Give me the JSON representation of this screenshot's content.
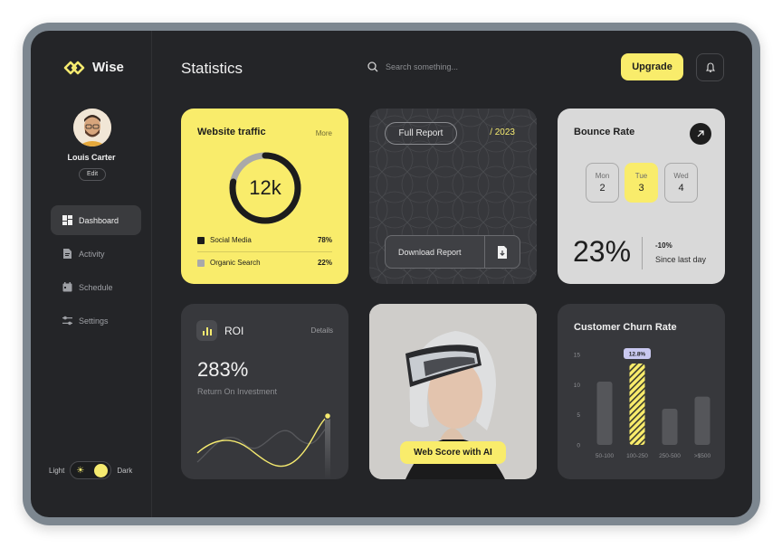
{
  "brand": {
    "name": "Wise"
  },
  "user": {
    "name": "Louis Carter",
    "edit_label": "Edit"
  },
  "nav": {
    "items": [
      {
        "label": "Dashboard",
        "icon": "grid-icon",
        "active": true
      },
      {
        "label": "Activity",
        "icon": "document-icon",
        "active": false
      },
      {
        "label": "Schedule",
        "icon": "calendar-icon",
        "active": false
      },
      {
        "label": "Settings",
        "icon": "sliders-icon",
        "active": false
      }
    ]
  },
  "theme": {
    "light_label": "Light",
    "dark_label": "Dark",
    "mode": "dark"
  },
  "header": {
    "title": "Statistics",
    "search_placeholder": "Search something...",
    "upgrade_label": "Upgrade"
  },
  "traffic": {
    "title": "Website traffic",
    "more_label": "More",
    "value": "12k",
    "ring_fraction": 0.78,
    "legend": [
      {
        "label": "Social Media",
        "percent": "78%",
        "color": "#1c1c1c"
      },
      {
        "label": "Organic Search",
        "percent": "22%",
        "color": "#a9a9a9"
      }
    ]
  },
  "report": {
    "full_report_label": "Full Report",
    "year": "/ 2023",
    "download_label": "Download Report"
  },
  "bounce": {
    "title": "Bounce Rate",
    "days": [
      {
        "name": "Mon",
        "date": "2",
        "active": false
      },
      {
        "name": "Tue",
        "date": "3",
        "active": true
      },
      {
        "name": "Wed",
        "date": "4",
        "active": false
      }
    ],
    "value": "23%",
    "change": "-10%",
    "since": "Since last day"
  },
  "roi": {
    "title": "ROI",
    "details_label": "Details",
    "value": "283%",
    "subtitle": "Return On Investment"
  },
  "photo": {
    "cta_label": "Web Score with AI"
  },
  "churn": {
    "title": "Customer Churn Rate",
    "tooltip": "12.8%"
  },
  "chart_data": {
    "type": "bar",
    "categories": [
      "50-100",
      "100-250",
      "250-500",
      ">$500"
    ],
    "values": [
      10.5,
      13.5,
      6,
      8
    ],
    "highlight_index": 1,
    "highlight_label": "12.8%",
    "ylim": [
      0,
      15
    ],
    "yticks": [
      0,
      5,
      10,
      15
    ],
    "title": "Customer Churn Rate"
  },
  "colors": {
    "accent": "#f9ec6b",
    "background": "#242528",
    "card": "#37383c"
  }
}
